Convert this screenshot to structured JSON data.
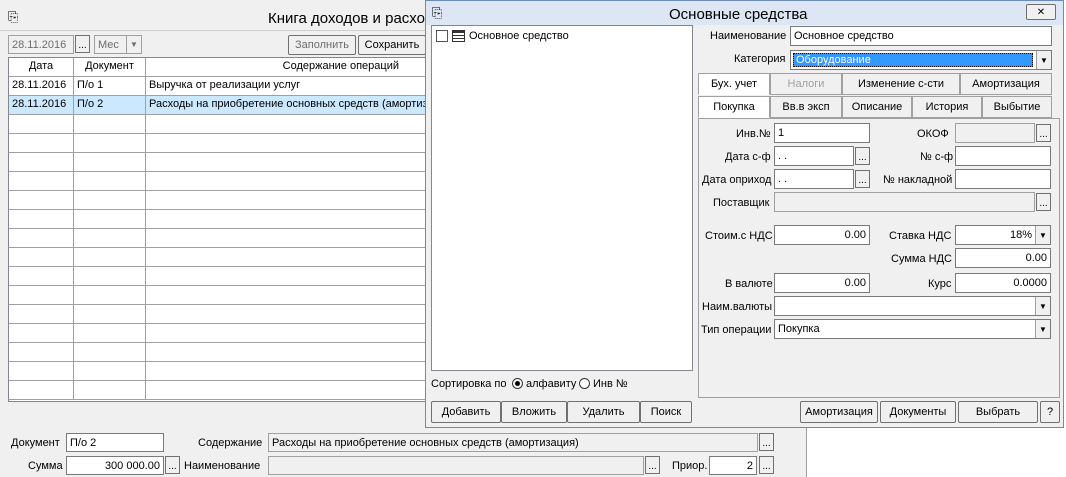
{
  "bg": {
    "title": "Книга доходов и расхо",
    "date": "28.11.2016",
    "period": "Мес",
    "fill_btn": "Заполнить",
    "save_btn": "Сохранить",
    "columns": [
      "Дата",
      "Документ",
      "Содержание операций"
    ],
    "rows": [
      {
        "date": "28.11.2016",
        "doc": "П/о 1",
        "desc": "Выручка от реализации услуг"
      },
      {
        "date": "28.11.2016",
        "doc": "П/о 2",
        "desc": "Расходы на приобретение основных средств (амортиза"
      }
    ],
    "form": {
      "doc_label": "Документ",
      "doc_value": "П/о 2",
      "content_label": "Содержание",
      "content_value": "Расходы на приобретение основных средств (амортизация)",
      "sum_label": "Сумма",
      "sum_value": "300 000.00",
      "name_label": "Наименование",
      "name_value": "",
      "prior_label": "Приор.",
      "prior_value": "2"
    }
  },
  "fg": {
    "title": "Основные средства",
    "close_glyph": "✕",
    "tree_item": "Основное средство",
    "sort_label": "Сортировка по",
    "sort_alpha": "алфавиту",
    "sort_inv": "Инв №",
    "buttons_left": [
      "Добавить",
      "Вложить",
      "Удалить",
      "Поиск"
    ],
    "buttons_right": [
      "Амортизация",
      "Документы",
      "Выбрать",
      "?"
    ],
    "name_label": "Наименование",
    "name_value": "Основное средство",
    "cat_label": "Категория",
    "cat_value": "Оборудование",
    "tabs_row1": [
      "Бух. учет",
      "Налоги",
      "Изменение с-сти",
      "Амортизация"
    ],
    "tabs_row2": [
      "Покупка",
      "Вв.в эксп",
      "Описание",
      "История",
      "Выбытие"
    ],
    "fields": {
      "inv_label": "Инв.№",
      "inv_value": "1",
      "okof_label": "ОКОФ",
      "okof_value": "",
      "datesf_label": "Дата с-ф",
      "datesf_value": " .  .",
      "nsf_label": "№ с-ф",
      "nsf_value": "",
      "dateopr_label": "Дата оприход",
      "dateopr_value": " .  .",
      "nnakl_label": "№ накладной",
      "nnakl_value": "",
      "supplier_label": "Поставщик",
      "supplier_value": "",
      "cost_label": "Стоим.с НДС",
      "cost_value": "0.00",
      "vat_rate_label": "Ставка НДС",
      "vat_rate_value": "18%",
      "vat_sum_label": "Сумма НДС",
      "vat_sum_value": "0.00",
      "curr_label": "В валюте",
      "curr_value": "0.00",
      "rate_label": "Курс",
      "rate_value": "0.0000",
      "currname_label": "Наим.валюты",
      "currname_value": "",
      "optype_label": "Тип операции",
      "optype_value": "Покупка"
    }
  },
  "colors": {
    "selection": "#cce8ff",
    "combo_highlight": "#3399ff",
    "title_active": "#dde6f4"
  }
}
